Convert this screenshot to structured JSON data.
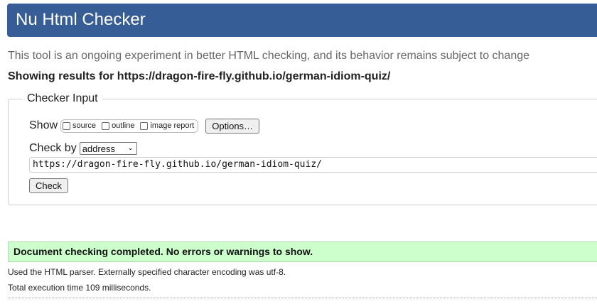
{
  "header": {
    "title": "Nu Html Checker",
    "accent_color": "#365d95"
  },
  "subtitle": "This tool is an ongoing experiment in better HTML checking, and its behavior remains subject to change",
  "showing_results": "Showing results for https://dragon-fire-fly.github.io/german-idiom-quiz/",
  "checker_input": {
    "legend": "Checker Input",
    "show_label": "Show",
    "options": [
      {
        "label": "source",
        "checked": false
      },
      {
        "label": "outline",
        "checked": false
      },
      {
        "label": "image report",
        "checked": false
      }
    ],
    "options_button": "Options…",
    "check_by_label": "Check by",
    "check_by_selected": "address",
    "url_value": "https://dragon-fire-fly.github.io/german-idiom-quiz/",
    "check_button": "Check"
  },
  "result": {
    "success_message": "Document checking completed. No errors or warnings to show.",
    "success_color": "#ccffcc",
    "parser_info": "Used the HTML parser. Externally specified character encoding was utf-8.",
    "execution_time": "Total execution time 109 milliseconds."
  }
}
